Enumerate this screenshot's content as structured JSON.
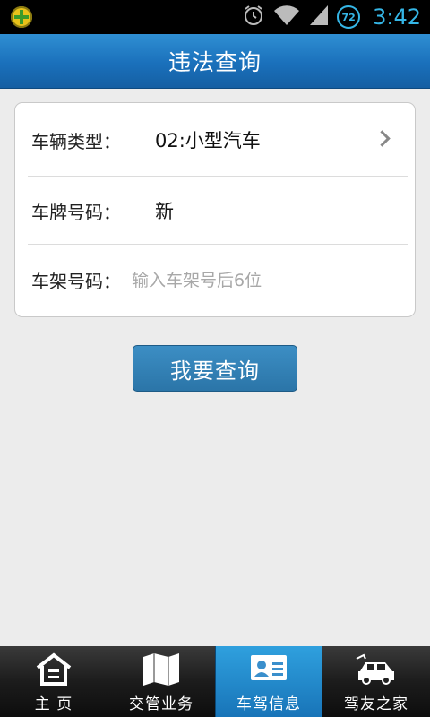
{
  "status_bar": {
    "app_icon": "plus-badge-icon",
    "icons": [
      "alarm-icon",
      "wifi-icon",
      "signal-icon",
      "battery-icon"
    ],
    "battery_level": "72",
    "time": "3:42",
    "accent_color": "#35b6e6"
  },
  "titlebar": {
    "title": "违法查询",
    "color": "#1a70bb"
  },
  "form": {
    "vehicle_type": {
      "label": "车辆类型：",
      "value": "02:小型汽车"
    },
    "plate_number": {
      "label": "车牌号码：",
      "value": "新"
    },
    "frame_number": {
      "label": "车架号码：",
      "value": "",
      "placeholder": "输入车架号后6位"
    }
  },
  "query_button": {
    "label": "我要查询"
  },
  "bottom_nav": {
    "tabs": [
      {
        "label": "主 页",
        "icon": "home-icon",
        "active": false
      },
      {
        "label": "交管业务",
        "icon": "map-icon",
        "active": false
      },
      {
        "label": "车驾信息",
        "icon": "id-card-icon",
        "active": true
      },
      {
        "label": "驾友之家",
        "icon": "car-icon",
        "active": false
      }
    ]
  }
}
